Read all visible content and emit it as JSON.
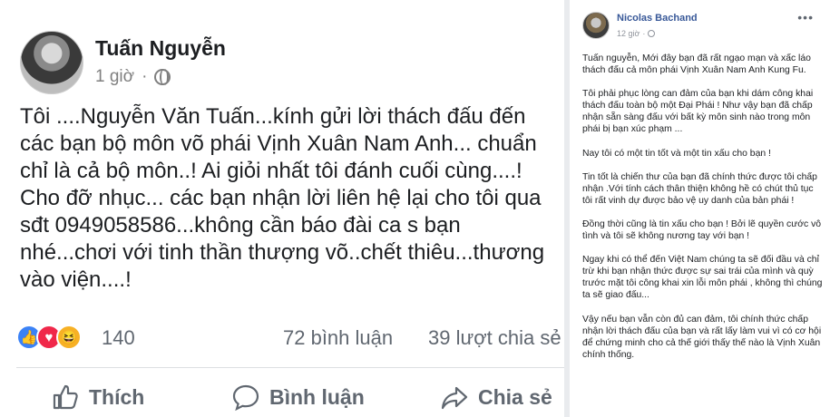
{
  "left_post": {
    "author": "Tuấn Nguyễn",
    "time": "1 giờ",
    "body_lines": [
      "Tôi ....Nguyễn Văn Tuấn...kính gửi lời thách đấu đến",
      "các bạn bộ môn võ phái Vịnh Xuân Nam Anh... chuẩn",
      "chỉ là cả bộ môn..! Ai giỏi nhất tôi đánh cuối cùng....!",
      "Cho đỡ nhục... các bạn nhận lời liên hệ lại cho tôi qua",
      "sđt 0949058586...không cần báo đài ca s bạn",
      "nhé...chơi với tinh thần thượng võ..chết thiêu...thương",
      "vào viện....!"
    ],
    "reaction_count": "140",
    "comment_count": "72 bình luận",
    "share_count": "39 lượt chia sẻ",
    "actions": {
      "like": "Thích",
      "comment": "Bình luận",
      "share": "Chia sẻ"
    },
    "reaction_icons": [
      "like-icon",
      "love-icon",
      "haha-icon"
    ]
  },
  "right_post": {
    "author": "Nicolas Bachand",
    "time": "12 giờ",
    "paragraphs": [
      "Tuấn nguyễn, Mới đây bạn đã rất ngạo mạn và xấc láo thách đấu cả môn phái Vịnh Xuân Nam Anh Kung Fu.",
      "Tôi phải phục lòng can đảm của bạn khi dám công khai thách đấu toàn bộ một Đại Phái ! Như vậy bạn đã chấp nhận sẵn sàng đấu với bất kỳ môn sinh nào trong môn phái bị bạn xúc phạm ...",
      "Nay tôi có một tin tốt và một tin xấu cho bạn !",
      "Tin tốt là chiến thư của bạn đã chính thức được tôi chấp nhận .Với tính cách thân thiện không hề có chút thủ tục tôi rất vinh dự được bảo vệ uy danh của bản phái !",
      "Đồng thời cũng là tin xấu cho bạn ! Bởi lẽ quyền cước vô tình và tôi sẽ không nương tay với bạn !",
      "Ngay khi có thể đến Việt Nam chúng ta sẽ đối đầu và chỉ trừ khi bạn nhận thức được sự sai trái của mình và quỳ trước mặt tôi công khai xin lỗi môn phái , không thì chúng ta sẽ giao đấu...",
      "Vậy nếu bạn vẫn còn đủ can đảm, tôi chính thức chấp nhận lời thách đấu của bạn và rất lấy làm vui vì có cơ hội để chứng minh cho cả thế giới thấy thế nào là Vịnh Xuân chính thống."
    ],
    "more_label": "•••"
  },
  "colors": {
    "link_blue": "#385898",
    "text": "#1c1e21",
    "secondary": "#606770",
    "like_blue": "#3b82f6",
    "love_red": "#f0284a",
    "haha_yellow": "#f7b125"
  }
}
